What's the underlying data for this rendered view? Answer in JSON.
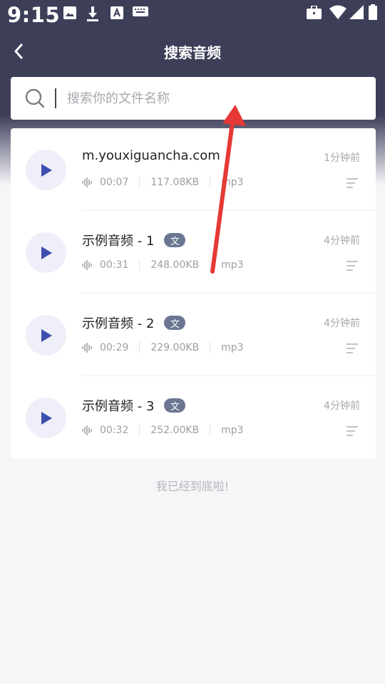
{
  "status_bar": {
    "time": "9:15",
    "left_icons": [
      "image-icon",
      "download-icon",
      "font-a-icon",
      "keyboard-icon"
    ],
    "right_icons": [
      "briefcase-icon",
      "wifi-icon",
      "signal-icon",
      "battery-icon"
    ]
  },
  "header": {
    "title": "搜索音频",
    "back_icon": "back-arrow-icon"
  },
  "search": {
    "value": "",
    "placeholder": "搜索你的文件名称"
  },
  "audio_list": [
    {
      "name": "m.youxiguancha.com",
      "badge": "",
      "time_ago": "1分钟前",
      "duration": "00:07",
      "size": "117.08KB",
      "format": "mp3"
    },
    {
      "name": "示例音频 - 1",
      "badge": "文",
      "time_ago": "4分钟前",
      "duration": "00:31",
      "size": "248.00KB",
      "format": "mp3"
    },
    {
      "name": "示例音频 - 2",
      "badge": "文",
      "time_ago": "4分钟前",
      "duration": "00:29",
      "size": "229.00KB",
      "format": "mp3"
    },
    {
      "name": "示例音频 - 3",
      "badge": "文",
      "time_ago": "4分钟前",
      "duration": "00:32",
      "size": "252.00KB",
      "format": "mp3"
    }
  ],
  "footer": {
    "end_text": "我已经到底啦!"
  },
  "colors": {
    "header_bg": "#3d3e58",
    "play_icon": "#3f4fb0",
    "play_bg": "#eeeff8",
    "badge_bg": "#6b7693",
    "annotation_arrow": "#e53935"
  }
}
